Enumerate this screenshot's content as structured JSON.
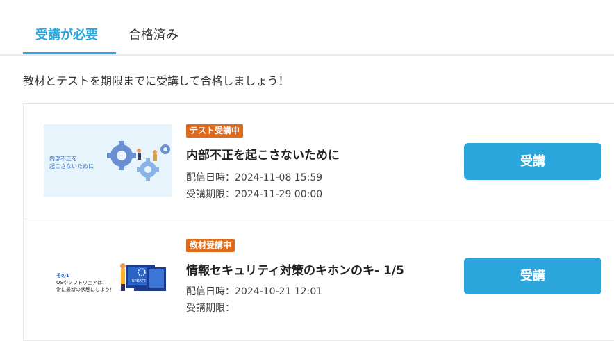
{
  "tabs": [
    {
      "label": "受講が必要"
    },
    {
      "label": "合格済み"
    }
  ],
  "intro": "教材とテストを期限までに受講して合格しましょう！",
  "courses": [
    {
      "badge": "テスト受講中",
      "title": "内部不正を起こさないために",
      "delivery_label": "配信日時：",
      "delivery": "2024-11-08 15:59",
      "deadline_label": "受講期限：",
      "deadline": "2024-11-29 00:00",
      "button": "受講",
      "thumb_text": [
        "内部不正を",
        "起こさないために"
      ]
    },
    {
      "badge": "教材受講中",
      "title": "情報セキュリティ対策のキホンのキ- 1/5",
      "delivery_label": "配信日時：",
      "delivery": "2024-10-21 12:01",
      "deadline_label": "受講期限：",
      "deadline": "",
      "button": "受講",
      "thumb_text": [
        "その1",
        "OSやソフトウェアは、",
        "常に最新の状態にしよう！"
      ],
      "thumb_screen": "UPDATE"
    }
  ],
  "colors": {
    "accent": "#2ba6dd",
    "badge": "#e06a1a"
  }
}
